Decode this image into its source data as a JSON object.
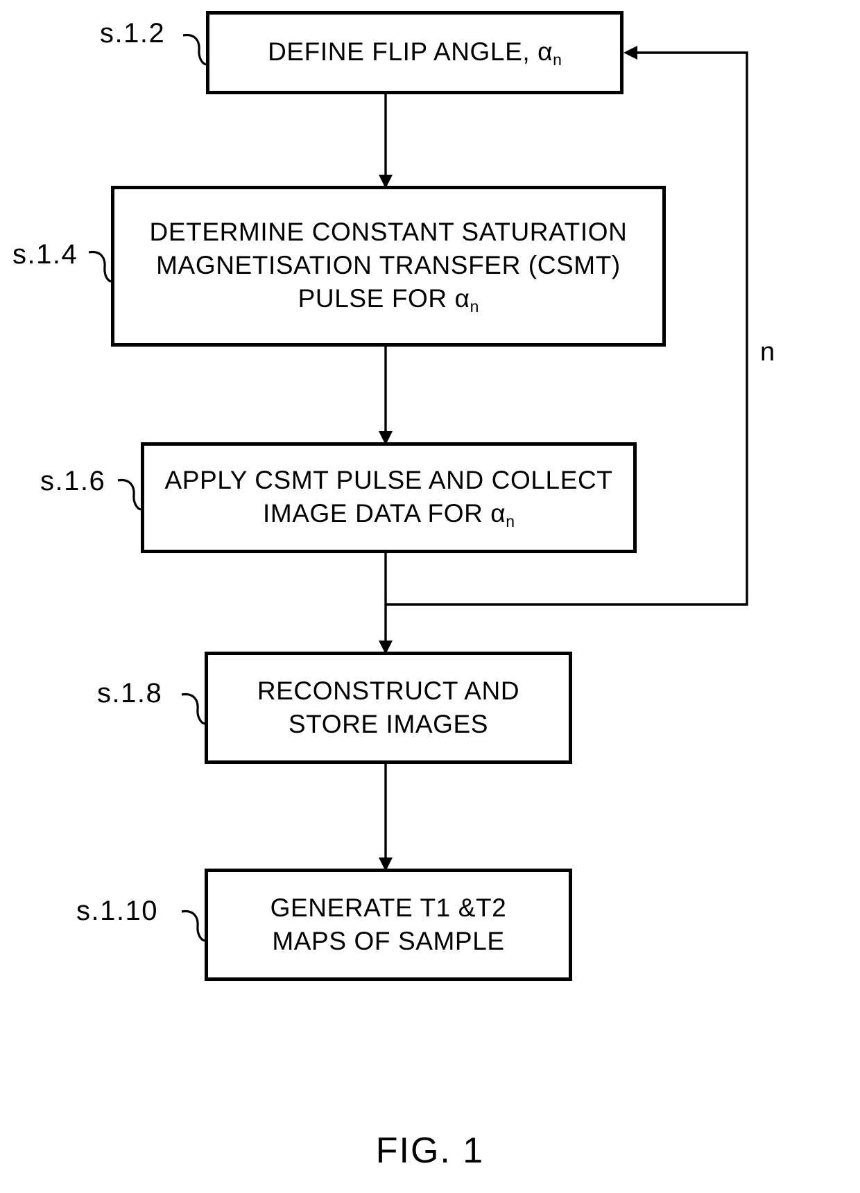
{
  "figure": {
    "caption": "FIG. 1",
    "type": "process-flowchart",
    "title": "CSMT variable flip angle MRI acquisition and T1/T2 mapping process"
  },
  "loop": {
    "index_label": "n",
    "description": "Feedback loop: repeats steps s.1.2 through s.1.6 for each flip angle index n"
  },
  "steps": [
    {
      "id": "s.1.2",
      "ref_label": "s.1.2",
      "text": "DEFINE FLIP ANGLE, α",
      "subscript": "n",
      "lines": [
        "DEFINE FLIP ANGLE, αn"
      ]
    },
    {
      "id": "s.1.4",
      "ref_label": "s.1.4",
      "text": "DETERMINE CONSTANT SATURATION\nMAGNETISATION TRANSFER (CSMT)\nPULSE FOR α",
      "subscript": "n",
      "lines": [
        "DETERMINE CONSTANT SATURATION",
        "MAGNETISATION TRANSFER (CSMT)",
        "PULSE FOR αn"
      ]
    },
    {
      "id": "s.1.6",
      "ref_label": "s.1.6",
      "text": "APPLY CSMT PULSE AND COLLECT\nIMAGE DATA FOR α",
      "subscript": "n",
      "lines": [
        "APPLY CSMT PULSE AND COLLECT",
        "IMAGE DATA FOR αn"
      ]
    },
    {
      "id": "s.1.8",
      "ref_label": "s.1.8",
      "text": "RECONSTRUCT AND\nSTORE IMAGES",
      "subscript": "",
      "lines": [
        "RECONSTRUCT AND",
        "STORE IMAGES"
      ]
    },
    {
      "id": "s.1.10",
      "ref_label": "s.1.10",
      "text": "GENERATE T1 &T2\nMAPS OF SAMPLE",
      "subscript": "",
      "lines": [
        "GENERATE T1 &T2",
        "MAPS OF SAMPLE"
      ]
    }
  ],
  "colors": {
    "ink": "#000000",
    "paper": "#ffffff"
  }
}
